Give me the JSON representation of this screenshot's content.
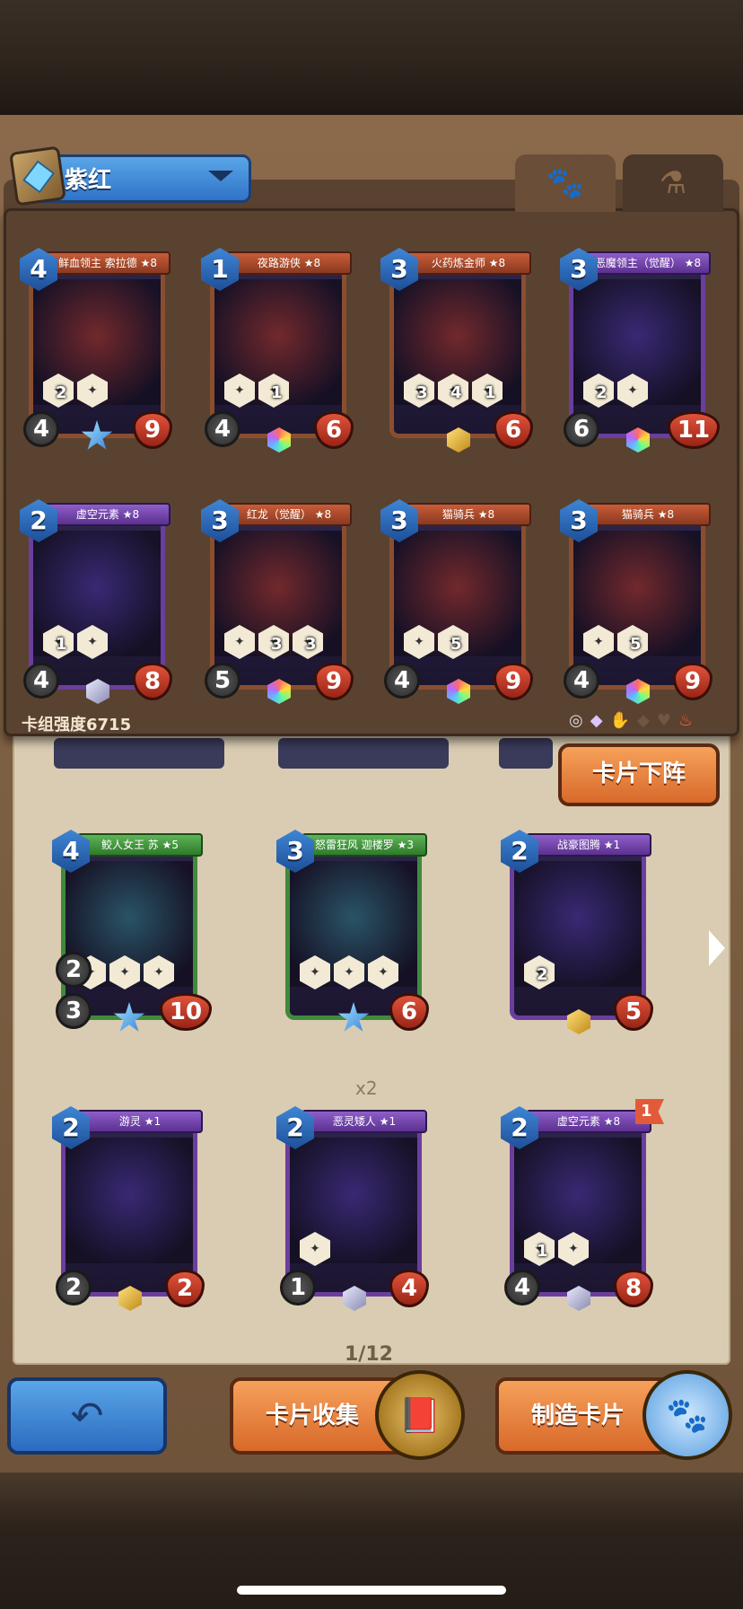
{
  "deck": {
    "name": "紫红",
    "power_label": "卡组强度6715"
  },
  "tabs": [
    {
      "icon": "paw-icon",
      "active": true
    },
    {
      "icon": "potion-icon",
      "active": false
    }
  ],
  "deck_cards": [
    {
      "name": "鲜血领主 索拉德 ★8",
      "cost": "4",
      "attack": "4",
      "hp": "9",
      "skills": [
        "2",
        ""
      ],
      "gem": "star",
      "faction": "red"
    },
    {
      "name": "夜路游侠 ★8",
      "cost": "1",
      "attack": "4",
      "hp": "6",
      "skills": [
        "",
        "1"
      ],
      "gem": "rainbow",
      "faction": "red"
    },
    {
      "name": "火药炼金师 ★8",
      "cost": "3",
      "attack": "",
      "hp": "6",
      "skills": [
        "3",
        "4",
        "1"
      ],
      "gem": "gold",
      "faction": "red"
    },
    {
      "name": "恶魔领主（觉醒） ★8",
      "cost": "3",
      "attack": "6",
      "hp": "11",
      "skills": [
        "2",
        ""
      ],
      "gem": "rainbow",
      "faction": "purple"
    },
    {
      "name": "虚空元素 ★8",
      "cost": "2",
      "attack": "4",
      "hp": "8",
      "skills": [
        "1",
        ""
      ],
      "gem": "silver",
      "faction": "purple"
    },
    {
      "name": "红龙（觉醒） ★8",
      "cost": "3",
      "attack": "5",
      "hp": "9",
      "skills": [
        "",
        "3",
        "3"
      ],
      "gem": "rainbow",
      "faction": "red"
    },
    {
      "name": "猫骑兵 ★8",
      "cost": "3",
      "attack": "4",
      "hp": "9",
      "skills": [
        "",
        "5"
      ],
      "gem": "rainbow",
      "faction": "red"
    },
    {
      "name": "猫骑兵 ★8",
      "cost": "3",
      "attack": "4",
      "hp": "9",
      "skills": [
        "",
        "5"
      ],
      "gem": "rainbow",
      "faction": "red"
    }
  ],
  "collection_cards": [
    {
      "name": "鲛人女王 苏 ★5",
      "cost": "4",
      "attack": "3",
      "hp": "10",
      "extra": "2",
      "skills": [
        "",
        "",
        ""
      ],
      "gem": "star",
      "faction": "green"
    },
    {
      "name": "怒雷狂风 迦楼罗 ★3",
      "cost": "3",
      "attack": "",
      "hp": "6",
      "skills": [
        "",
        "",
        ""
      ],
      "gem": "star",
      "faction": "green"
    },
    {
      "name": "战豪图腾 ★1",
      "cost": "2",
      "attack": "",
      "hp": "5",
      "skills": [
        "2"
      ],
      "gem": "gold",
      "faction": "purple"
    },
    {
      "name": "游灵 ★1",
      "cost": "2",
      "attack": "2",
      "hp": "2",
      "skills": [],
      "gem": "gold",
      "faction": "purple"
    },
    {
      "name": "恶灵矮人 ★1",
      "cost": "2",
      "attack": "1",
      "hp": "4",
      "skills": [
        ""
      ],
      "gem": "silver",
      "faction": "purple"
    },
    {
      "name": "虚空元素 ★8",
      "cost": "2",
      "attack": "4",
      "hp": "8",
      "skills": [
        "1",
        ""
      ],
      "gem": "silver",
      "faction": "purple",
      "flag": "1"
    }
  ],
  "collection": {
    "count_label": "x2",
    "page_label": "1/12"
  },
  "buttons": {
    "remove": "卡片下阵",
    "collect": "卡片收集",
    "craft": "制造卡片"
  },
  "colors": {
    "accent_orange": "#e07a36",
    "accent_blue": "#3f86d6",
    "panel_brown": "#5a4231"
  }
}
